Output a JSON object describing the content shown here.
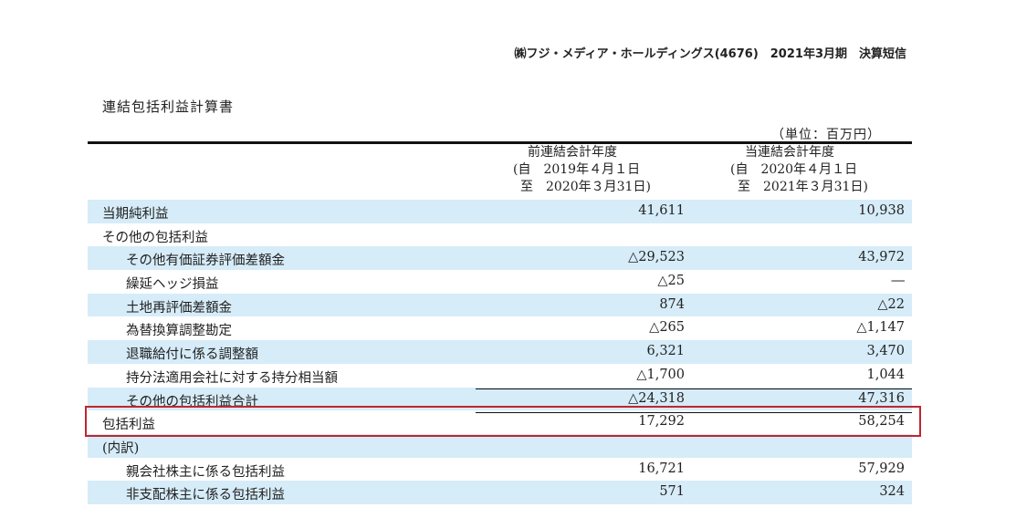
{
  "header": {
    "company_line": "㈱フジ・メディア・ホールディングス(4676)　2021年3月期　決算短信"
  },
  "title": "連結包括利益計算書",
  "unit": "（単位：百万円）",
  "columns": {
    "prev": {
      "line1": "前連結会計年度",
      "line2": "(自　2019年４月１日",
      "line3": "至　2020年３月31日)"
    },
    "curr": {
      "line1": "当連結会計年度",
      "line2": "(自　2020年４月１日",
      "line3": "至　2021年３月31日)"
    }
  },
  "rows": [
    {
      "label": "当期純利益",
      "prev": "41,611",
      "curr": "10,938"
    },
    {
      "label": "その他の包括利益",
      "prev": "",
      "curr": ""
    },
    {
      "label": "その他有価証券評価差額金",
      "prev": "△29,523",
      "curr": "43,972"
    },
    {
      "label": "繰延ヘッジ損益",
      "prev": "△25",
      "curr": "―"
    },
    {
      "label": "土地再評価差額金",
      "prev": "874",
      "curr": "△22"
    },
    {
      "label": "為替換算調整勘定",
      "prev": "△265",
      "curr": "△1,147"
    },
    {
      "label": "退職給付に係る調整額",
      "prev": "6,321",
      "curr": "3,470"
    },
    {
      "label": "持分法適用会社に対する持分相当額",
      "prev": "△1,700",
      "curr": "1,044"
    },
    {
      "label": "その他の包括利益合計",
      "prev": "△24,318",
      "curr": "47,316"
    },
    {
      "label": "包括利益",
      "prev": "17,292",
      "curr": "58,254"
    },
    {
      "label": "(内訳)",
      "prev": "",
      "curr": ""
    },
    {
      "label": "親会社株主に係る包括利益",
      "prev": "16,721",
      "curr": "57,929"
    },
    {
      "label": "非支配株主に係る包括利益",
      "prev": "571",
      "curr": "324"
    }
  ],
  "colors": {
    "row_shade": "#d6ecf8",
    "highlight_box": "#c0262d"
  }
}
